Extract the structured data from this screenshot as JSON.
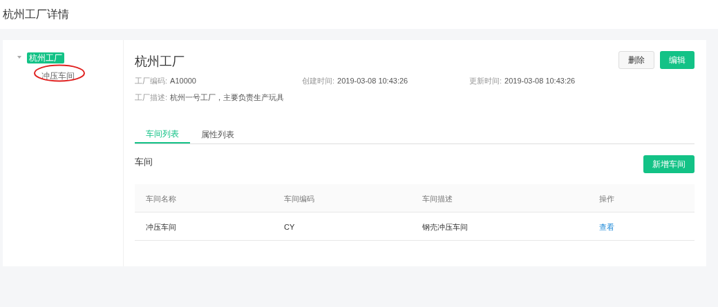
{
  "page_title": "杭州工厂详情",
  "tree": [
    {
      "label": "杭州工厂",
      "selected": true,
      "expanded": true,
      "children": [
        {
          "label": "冲压车间",
          "selected": false,
          "circled": true
        }
      ]
    }
  ],
  "detail": {
    "title": "杭州工厂",
    "actions": [
      {
        "label": "删除",
        "kind": "default"
      },
      {
        "label": "编辑",
        "kind": "primary"
      }
    ],
    "fields": [
      {
        "label": "工厂编码:",
        "value": "A10000"
      },
      {
        "label": "创建时间:",
        "value": "2019-03-08 10:43:26"
      },
      {
        "label": "更新时间:",
        "value": "2019-03-08 10:43:26"
      }
    ],
    "description": {
      "label": "工厂描述:",
      "value": "杭州一号工厂，主要负责生产玩具"
    }
  },
  "tabs": [
    {
      "label": "车间列表",
      "selected": true
    },
    {
      "label": "属性列表",
      "selected": false
    }
  ],
  "section": {
    "title": "车间",
    "add_button": "新增车间"
  },
  "table": {
    "columns": [
      "车间名称",
      "车间编码",
      "车间描述",
      "操作"
    ],
    "rows": [
      {
        "cells": [
          "冲压车间",
          "CY",
          "钢壳冲压车间"
        ],
        "action": "查看"
      }
    ]
  },
  "annotation": {
    "kind": "ellipse",
    "color": "#e0201f"
  }
}
